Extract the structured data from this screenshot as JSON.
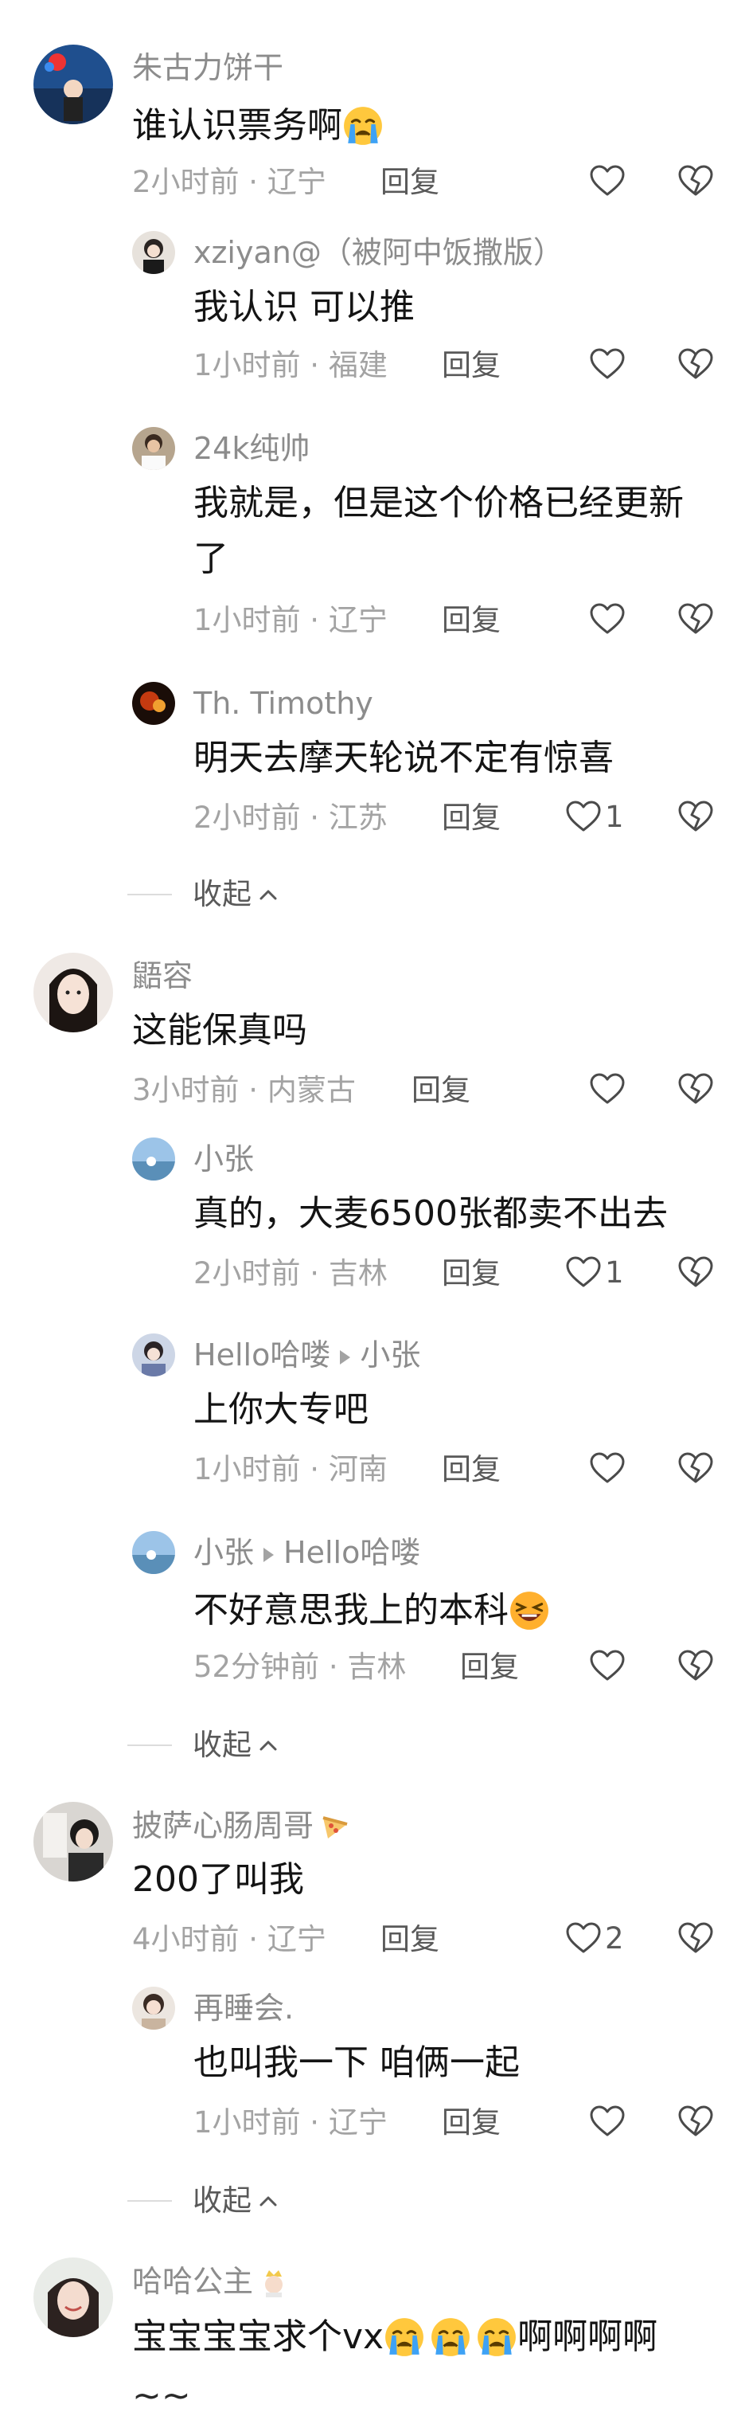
{
  "comments": [
    {
      "name": "朱古力饼干",
      "text": "谁认识票务啊",
      "time": "2小时前 · 辽宁",
      "reply": "回复",
      "likes": ""
    },
    {
      "name": "xziyan@（被阿中饭撒版）",
      "text": "我认识 可以推",
      "time": "1小时前 · 福建",
      "reply": "回复",
      "likes": ""
    },
    {
      "name": "24k纯帅",
      "text_line1": "我就是，但是这个价格已经更新",
      "text_line2": "了",
      "time": "1小时前 · 辽宁",
      "reply": "回复",
      "likes": ""
    },
    {
      "name": "Th. Timothy",
      "text": "明天去摩天轮说不定有惊喜",
      "time": "2小时前 · 江苏",
      "reply": "回复",
      "likes": "1"
    },
    {
      "name": "鼯容",
      "text": "这能保真吗",
      "time": "3小时前 · 内蒙古",
      "reply": "回复",
      "likes": ""
    },
    {
      "name": "小张",
      "text": "真的，大麦6500张都卖不出去",
      "time": "2小时前 · 吉林",
      "reply": "回复",
      "likes": "1"
    },
    {
      "name": "Hello哈喽",
      "reply_to": "小张",
      "text": "上你大专吧",
      "time": "1小时前 · 河南",
      "reply": "回复",
      "likes": ""
    },
    {
      "name": "小张",
      "reply_to": "Hello哈喽",
      "text": "不好意思我上的本科",
      "time": "52分钟前 · 吉林",
      "reply": "回复",
      "likes": ""
    },
    {
      "name": "披萨心肠周哥",
      "text": "200了叫我",
      "time": "4小时前 · 辽宁",
      "reply": "回复",
      "likes": "2"
    },
    {
      "name": "再睡会.",
      "text": "也叫我一下 咱俩一起",
      "time": "1小时前 · 辽宁",
      "reply": "回复",
      "likes": ""
    },
    {
      "name": "哈哈公主",
      "text": "宝宝宝宝求个vx",
      "text_tail": "啊啊啊啊",
      "partial_line": "~~"
    }
  ],
  "collapse_label": "收起",
  "icons": {
    "like": "heart-icon",
    "dislike": "broken-heart-icon",
    "collapse": "chevron-up-icon",
    "crying": "crying-emoji",
    "laughing": "laughing-emoji",
    "pizza": "pizza-emoji",
    "crown": "princess-emoji"
  },
  "colors": {
    "name": "#8c8c8c",
    "text": "#141414",
    "meta": "#a3a3a3",
    "reply": "#595959"
  }
}
